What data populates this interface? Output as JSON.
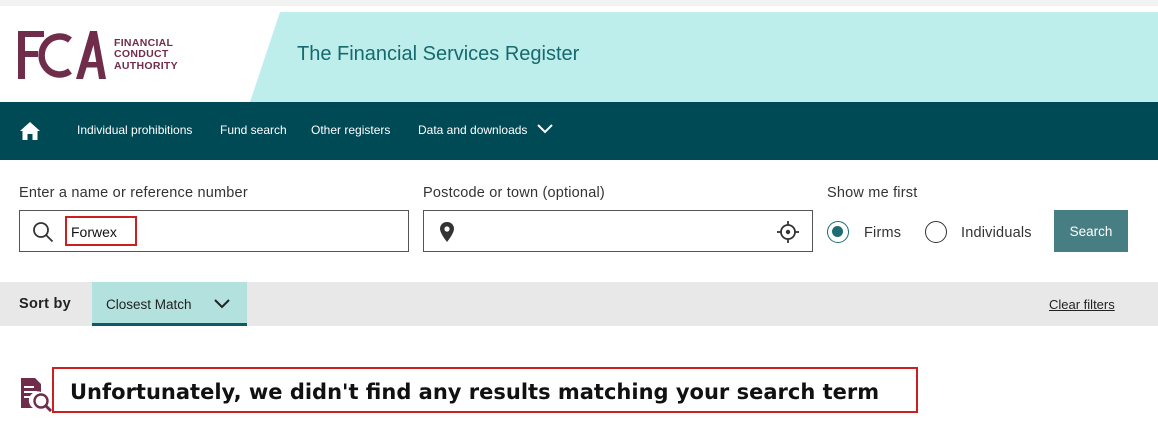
{
  "header": {
    "logo_letters": "FCA",
    "logo_text": [
      "Financial",
      "Conduct",
      "Authority"
    ],
    "title": "The Financial Services Register",
    "band_color": "#bdeeeb",
    "brand_color": "#702d4b"
  },
  "nav": {
    "home_icon": "home-icon",
    "items": [
      "Individual prohibitions",
      "Fund search",
      "Other registers",
      "Data and downloads"
    ],
    "background": "#004a55"
  },
  "search": {
    "name_label": "Enter a name or reference number",
    "name_value": "Forwex",
    "postcode_label": "Postcode or town (optional)",
    "postcode_value": "",
    "show_me_first_label": "Show me first",
    "options": [
      "Firms",
      "Individuals"
    ],
    "selected_option": "Firms",
    "search_button": "Search",
    "button_color": "#477e84"
  },
  "sort": {
    "label": "Sort by",
    "selected": "Closest Match",
    "clear_filters": "Clear filters"
  },
  "result": {
    "icon": "document-search-icon",
    "message": "Unfortunately, we didn't find any results matching your search term"
  }
}
